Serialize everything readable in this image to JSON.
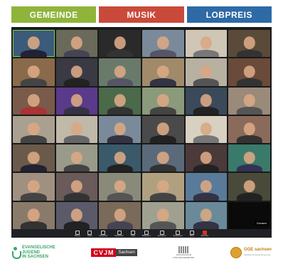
{
  "banner": {
    "left": "GEMEINDE",
    "center": "MUSIK",
    "right": "LOBPREIS"
  },
  "meeting": {
    "active_speaker_label": "Donsen",
    "tiles": [
      {
        "bg": "#3c5a7a",
        "shirt": "#223",
        "name": ""
      },
      {
        "bg": "#6a6a5a",
        "shirt": "#445",
        "name": ""
      },
      {
        "bg": "#2a2a2a",
        "shirt": "#333",
        "name": ""
      },
      {
        "bg": "#7a8a9a",
        "shirt": "#556",
        "name": ""
      },
      {
        "bg": "#cfc6b5",
        "shirt": "#777",
        "name": ""
      },
      {
        "bg": "#5a4a3a",
        "shirt": "#333",
        "name": ""
      },
      {
        "bg": "#8a6a4a",
        "shirt": "#444",
        "name": ""
      },
      {
        "bg": "#3a3a44",
        "shirt": "#222",
        "name": ""
      },
      {
        "bg": "#6a7a6a",
        "shirt": "#556",
        "name": ""
      },
      {
        "bg": "#a08a6a",
        "shirt": "#334",
        "name": ""
      },
      {
        "bg": "#b8b0a0",
        "shirt": "#555",
        "name": ""
      },
      {
        "bg": "#6a4a3a",
        "shirt": "#333",
        "name": ""
      },
      {
        "bg": "#7a5a4a",
        "shirt": "#a33",
        "name": ""
      },
      {
        "bg": "#5a3a8a",
        "shirt": "#334",
        "name": ""
      },
      {
        "bg": "#4a6a4a",
        "shirt": "#333",
        "name": ""
      },
      {
        "bg": "#8a9a7a",
        "shirt": "#444",
        "name": ""
      },
      {
        "bg": "#3a4a5a",
        "shirt": "#222",
        "name": ""
      },
      {
        "bg": "#9a8a7a",
        "shirt": "#555",
        "name": ""
      },
      {
        "bg": "#aaa090",
        "shirt": "#444",
        "name": ""
      },
      {
        "bg": "#c0b8a8",
        "shirt": "#666",
        "name": ""
      },
      {
        "bg": "#7a8a9a",
        "shirt": "#334",
        "name": ""
      },
      {
        "bg": "#4a4a4a",
        "shirt": "#222",
        "name": ""
      },
      {
        "bg": "#d8d0c0",
        "shirt": "#777",
        "name": ""
      },
      {
        "bg": "#8a6a5a",
        "shirt": "#333",
        "name": ""
      },
      {
        "bg": "#6a5a4a",
        "shirt": "#223",
        "name": ""
      },
      {
        "bg": "#9a9a8a",
        "shirt": "#444",
        "name": ""
      },
      {
        "bg": "#3a5a6a",
        "shirt": "#222",
        "name": ""
      },
      {
        "bg": "#5a6a7a",
        "shirt": "#333",
        "name": ""
      },
      {
        "bg": "#4a3a3a",
        "shirt": "#222",
        "name": ""
      },
      {
        "bg": "#3a7a6a",
        "shirt": "#335",
        "name": ""
      },
      {
        "bg": "#a09080",
        "shirt": "#444",
        "name": ""
      },
      {
        "bg": "#6a5a5a",
        "shirt": "#333",
        "name": ""
      },
      {
        "bg": "#8a8a7a",
        "shirt": "#555",
        "name": ""
      },
      {
        "bg": "#b0a080",
        "shirt": "#444",
        "name": ""
      },
      {
        "bg": "#5a7a9a",
        "shirt": "#334",
        "name": ""
      },
      {
        "bg": "#4a4a3a",
        "shirt": "#222",
        "name": ""
      },
      {
        "bg": "#8a7a6a",
        "shirt": "#333",
        "name": ""
      },
      {
        "bg": "#5a5a6a",
        "shirt": "#222",
        "name": ""
      },
      {
        "bg": "#7a6a5a",
        "shirt": "#445",
        "name": ""
      },
      {
        "bg": "#a0a090",
        "shirt": "#555",
        "name": ""
      },
      {
        "bg": "#6a8a9a",
        "shirt": "#334",
        "name": ""
      },
      {
        "bg": "#0a0a0a",
        "shirt": "#0a0a0a",
        "name": ""
      }
    ],
    "toolbar": [
      {
        "label": "Stumm",
        "icon": "mic-icon"
      },
      {
        "label": "Video",
        "icon": "camera-icon"
      },
      {
        "label": "Sicherheit",
        "icon": "shield-icon"
      },
      {
        "label": "Teilnehmer",
        "icon": "people-icon"
      },
      {
        "label": "Chat",
        "icon": "chat-icon"
      },
      {
        "label": "Bildschirm",
        "icon": "share-icon"
      },
      {
        "label": "Aufnahme",
        "icon": "record-icon"
      },
      {
        "label": "Reaktionen",
        "icon": "reaction-icon"
      },
      {
        "label": "Mehr",
        "icon": "more-icon"
      },
      {
        "label": "Beenden",
        "icon": "end-call-icon"
      }
    ]
  },
  "footer": {
    "ej": [
      "EVANGELISCHE",
      "JUGEND",
      "IN SACHSEN"
    ],
    "cvjm": "CVJM",
    "cvjm_region": "Sachsen",
    "hochschule": [
      "HOCHSCHULE",
      "FÜR KIRCHENMUSIK"
    ],
    "gge": "GGE sachsen",
    "gge_sub": "Geistliche Gemeinde-Erneuerung"
  }
}
